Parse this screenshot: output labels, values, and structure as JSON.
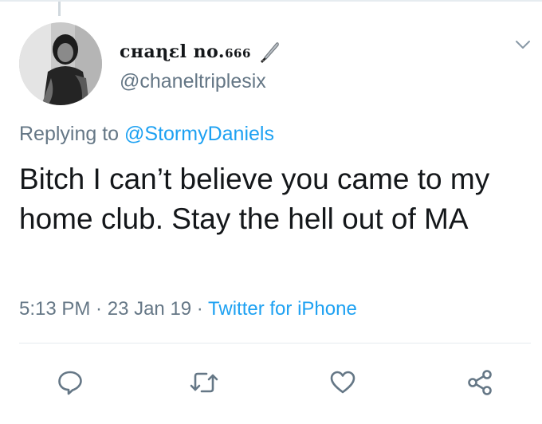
{
  "tweet": {
    "display_name_main": "cʜaɳɛl no.",
    "display_name_sub": "666",
    "name_emoji": "knife-icon",
    "handle": "@chaneltriplesix",
    "replying_prefix": "Replying to ",
    "replying_handle": "@StormyDaniels",
    "text": "Bitch I can’t believe you came to my home club. Stay the hell out of MA",
    "time": "5:13 PM",
    "separator": " · ",
    "date": "23 Jan 19",
    "source": "Twitter for iPhone"
  },
  "colors": {
    "secondary_text": "#657786",
    "link": "#1da1f2",
    "primary_text": "#14171a",
    "divider": "#e6ecf0"
  },
  "actions": [
    "reply-icon",
    "retweet-icon",
    "like-icon",
    "share-icon"
  ]
}
